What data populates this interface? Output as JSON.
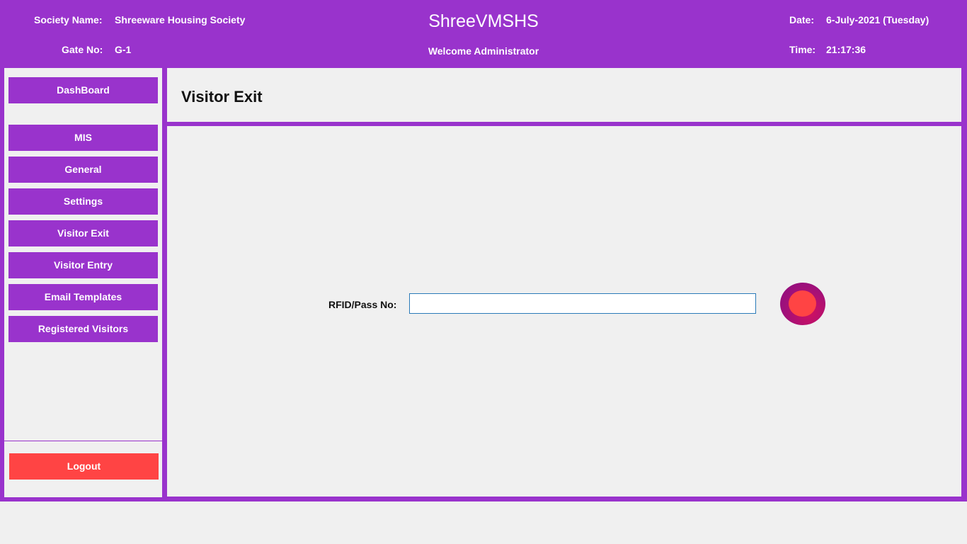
{
  "header": {
    "society_label": "Society Name:",
    "society_value": "Shreeware Housing Society",
    "gate_label": "Gate No:",
    "gate_value": "G-1",
    "app_title": "ShreeVMSHS",
    "welcome": "Welcome Administrator",
    "date_label": "Date:",
    "date_value": "6-July-2021 (Tuesday)",
    "time_label": "Time:",
    "time_value": "21:17:36"
  },
  "sidebar": {
    "items": [
      {
        "label": "DashBoard"
      },
      {
        "label": "MIS"
      },
      {
        "label": "General"
      },
      {
        "label": "Settings"
      },
      {
        "label": "Visitor Exit"
      },
      {
        "label": "Visitor Entry"
      },
      {
        "label": "Email Templates"
      },
      {
        "label": "Registered Visitors"
      }
    ],
    "logout_label": "Logout"
  },
  "main": {
    "page_title": "Visitor Exit",
    "rfid_label": "RFID/Pass No:",
    "rfid_value": "",
    "rfid_placeholder": ""
  },
  "colors": {
    "brand": "#9933cc",
    "logout": "#ff4444",
    "status_outer": "#a0107a",
    "status_inner": "#ff4444",
    "panel_bg": "#f0f0f0"
  },
  "icons": {
    "status": "status-indicator-icon"
  }
}
